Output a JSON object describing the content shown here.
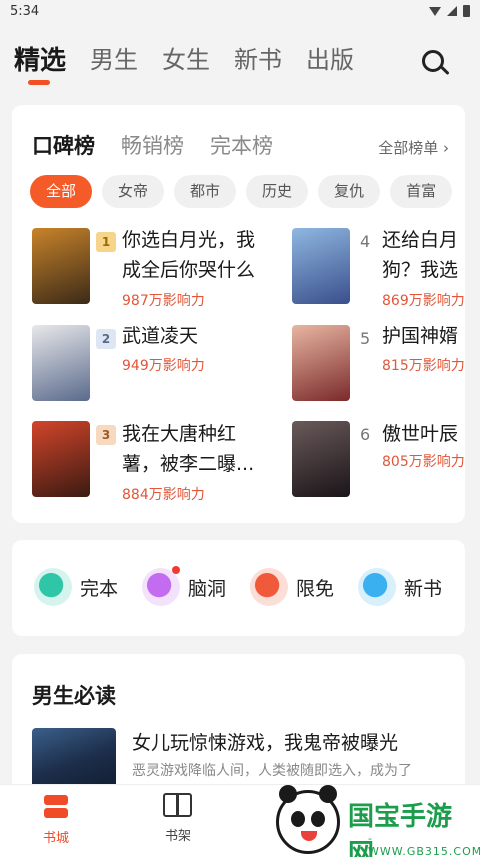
{
  "status_bar": {
    "time": "5:34"
  },
  "top_tabs": [
    "精选",
    "男生",
    "女生",
    "新书",
    "出版"
  ],
  "ranking": {
    "tabs": [
      "口碑榜",
      "畅销榜",
      "完本榜"
    ],
    "all_link": "全部榜单 ›",
    "chips": [
      "全部",
      "女帝",
      "都市",
      "历史",
      "复仇",
      "首富"
    ],
    "left_books": [
      {
        "rank": "1",
        "title_line1": "你选白月光，我",
        "title_line2": "成全后你哭什么",
        "impact": "987万影响力",
        "cover_colors": [
          "#c8832a",
          "#3b2a18"
        ]
      },
      {
        "rank": "2",
        "title_line1": "武道凌天",
        "title_line2": "",
        "impact": "949万影响力",
        "cover_colors": [
          "#e8e8ea",
          "#5a6a8c"
        ]
      },
      {
        "rank": "3",
        "title_line1": "我在大唐种红",
        "title_line2": "薯，被李二曝...",
        "impact": "884万影响力",
        "cover_colors": [
          "#d2452a",
          "#3a1a12"
        ]
      }
    ],
    "right_books": [
      {
        "rank": "4",
        "title_line1": "还给白月",
        "title_line2": "狗？我选",
        "impact": "869万影响力",
        "cover_colors": [
          "#8fb7e0",
          "#3a4f8c"
        ]
      },
      {
        "rank": "5",
        "title_line1": "护国神婿",
        "title_line2": "",
        "impact": "815万影响力",
        "cover_colors": [
          "#e8b6a2",
          "#7a2a2a"
        ]
      },
      {
        "rank": "6",
        "title_line1": "傲世叶辰",
        "title_line2": "",
        "impact": "805万影响力",
        "cover_colors": [
          "#6a5a5a",
          "#1a1418"
        ]
      }
    ]
  },
  "categories": [
    {
      "label": "完本",
      "color": "#2fc6a8"
    },
    {
      "label": "脑洞",
      "color": "#c36cf0"
    },
    {
      "label": "限免",
      "color": "#f05a3a"
    },
    {
      "label": "新书",
      "color": "#3ab0f0"
    }
  ],
  "must_read": {
    "title": "男生必读",
    "book_title": "女儿玩惊悚游戏，我鬼帝被曝光",
    "book_desc": "恶灵游戏降临人间，人类被随即选入，成为了"
  },
  "bottom_nav": [
    "书城",
    "书架"
  ],
  "watermark": {
    "text": "国宝手游网",
    "url": "-WWW.GB315.COM-"
  },
  "colors": {
    "accent": "#f45b28",
    "impact": "#e2563a",
    "watermark": "#1b9d4c"
  }
}
